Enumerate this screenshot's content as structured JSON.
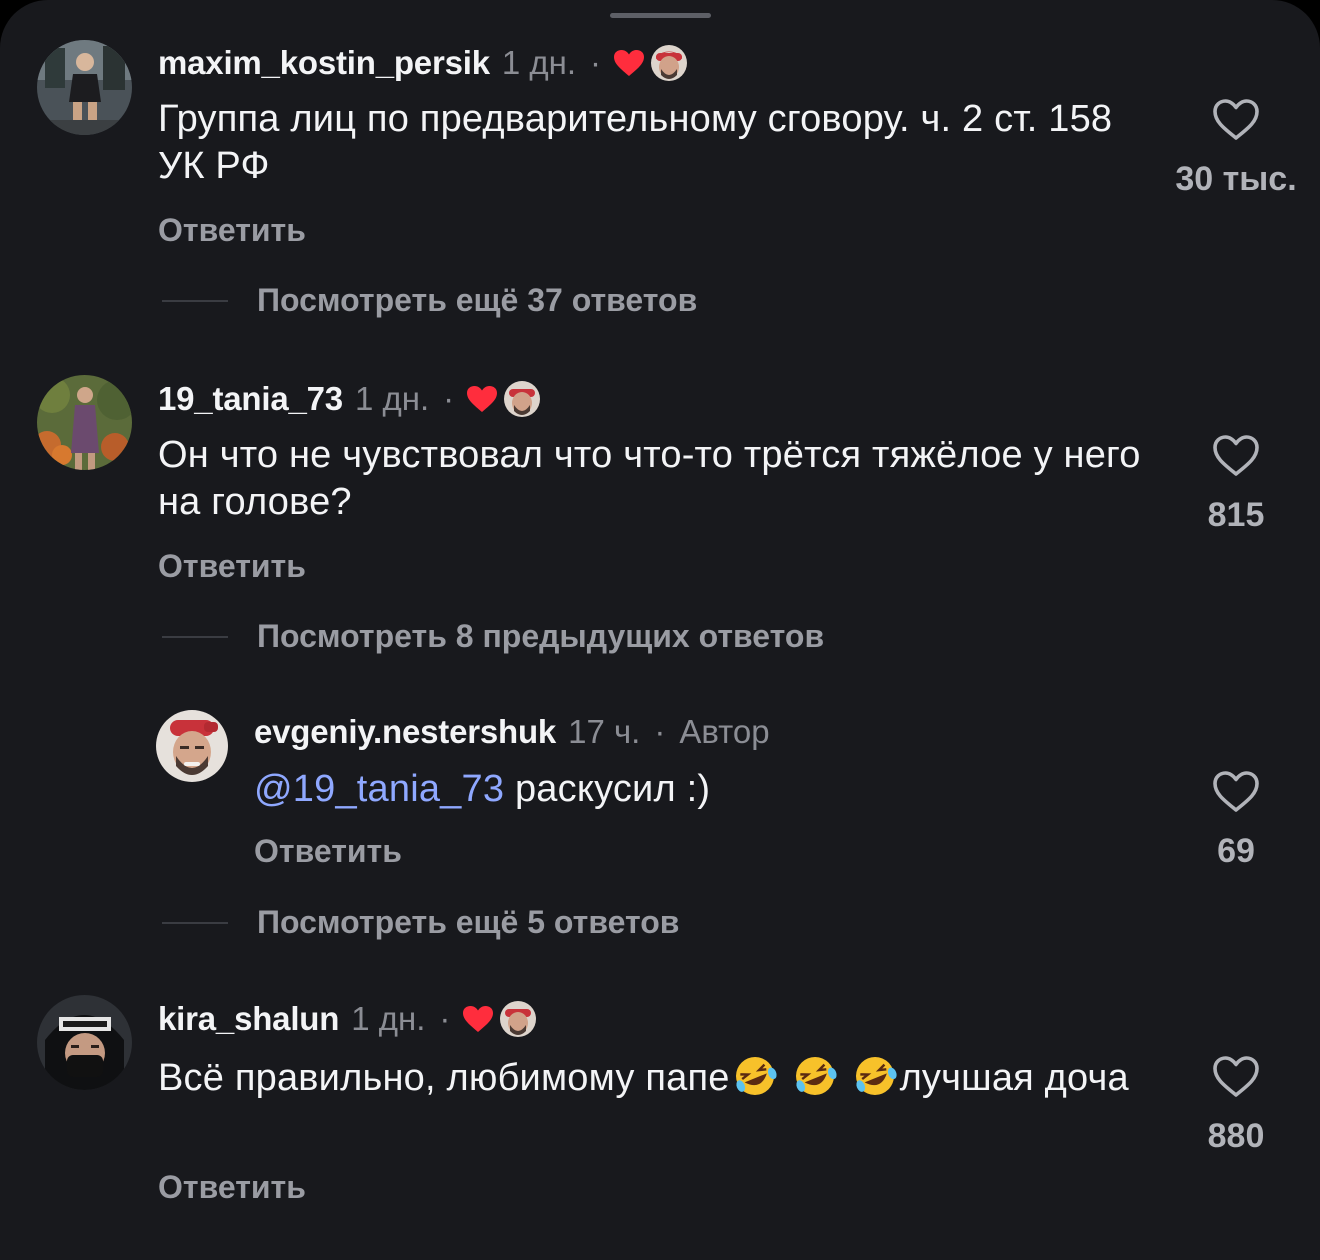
{
  "colors": {
    "background": "#18191d",
    "text": "#f3f4f6",
    "secondary": "#8b8d94",
    "mention": "#8fa8ff",
    "heart_red": "#ff2d3d"
  },
  "comments": [
    {
      "username": "maxim_kostin_persik",
      "time": "1 дн.",
      "dot": "·",
      "text": "Группа лиц по предварительному сговору. ч. 2 ст. 158 УК РФ",
      "reply": "Ответить",
      "likes": "30 тыс.",
      "thread": "Посмотреть ещё 37 ответов"
    },
    {
      "username": "19_tania_73",
      "time": "1 дн.",
      "dot": "·",
      "text": "Он что не чувствовал что что-то трётся тяжёлое у него на голове?",
      "reply": "Ответить",
      "likes": "815",
      "thread": "Посмотреть 8 предыдущих ответов"
    },
    {
      "username": "evgeniy.nestershuk",
      "time": "17 ч.",
      "dot": "·",
      "author_label": "Автор",
      "mention": "@19_tania_73",
      "text": " раскусил :)",
      "reply": "Ответить",
      "likes": "69",
      "thread": "Посмотреть ещё 5 ответов"
    },
    {
      "username": "kira_shalun",
      "time": "1 дн.",
      "dot": "·",
      "text_before": "Всё правильно, любимому папе",
      "emoji": "rolling-on-floor-laughing-emoji",
      "text_after": "лучшая дочa",
      "reply": "Ответить",
      "likes": "880"
    }
  ]
}
